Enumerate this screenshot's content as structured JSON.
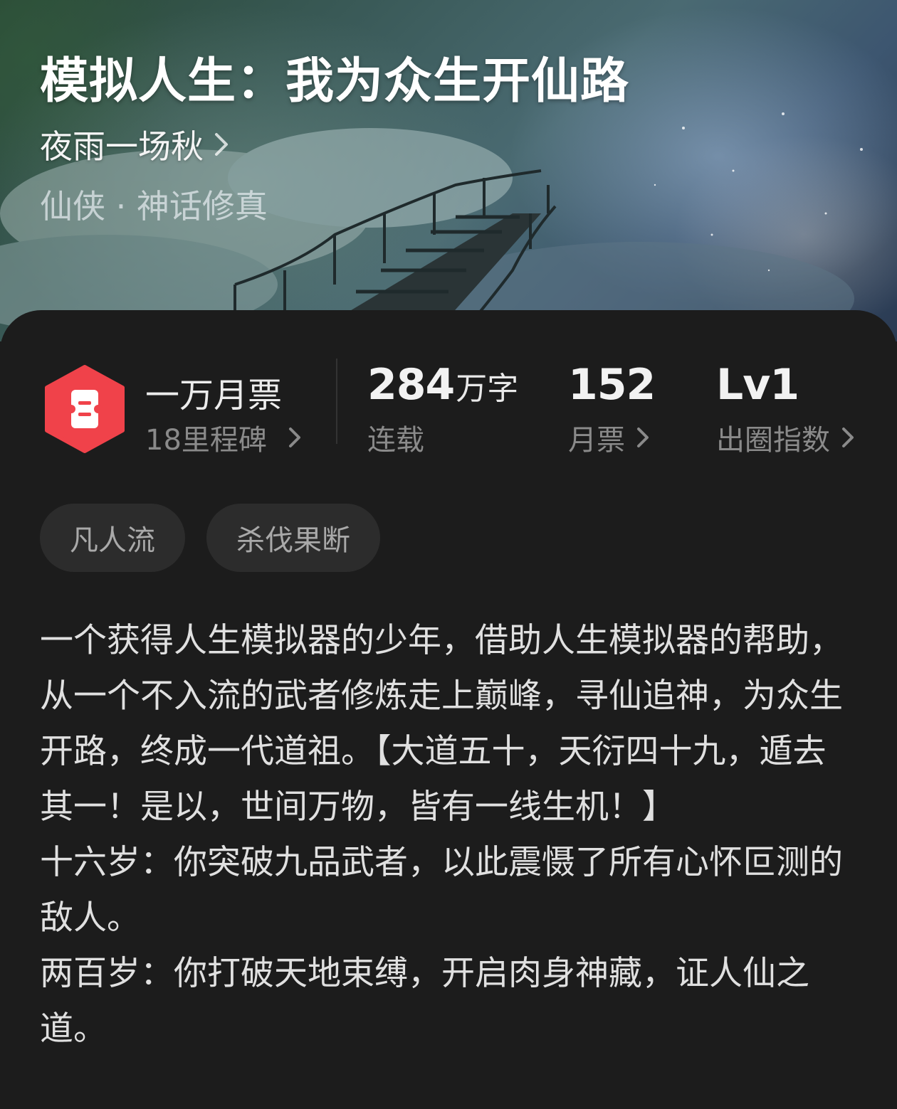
{
  "book": {
    "title": "模拟人生：我为众生开仙路",
    "author": "夜雨一场秋",
    "genre": "仙侠 · 神话修真"
  },
  "stats": {
    "badge": {
      "title": "一万月票",
      "subtitle": "18里程碑"
    },
    "word_count": {
      "number": "284",
      "unit": "万字",
      "label": "连载"
    },
    "monthly_tickets": {
      "number": "152",
      "label": "月票"
    },
    "influence": {
      "number": "Lv1",
      "label": "出圈指数"
    }
  },
  "tags": [
    "凡人流",
    "杀伐果断"
  ],
  "synopsis": [
    "一个获得人生模拟器的少年，借助人生模拟器的帮助，从一个不入流的武者修炼走上巅峰，寻仙追神，为众生开路，终成一代道祖。【大道五十，天衍四十九，遁去其一！是以，世间万物，皆有一线生机！】",
    "十六岁：你突破九品武者，以此震慑了所有心怀叵测的敌人。",
    "两百岁：你打破天地束缚，开启肉身神藏，证人仙之道。"
  ],
  "colors": {
    "badge_red": "#f0424a",
    "panel_bg": "#1c1c1c",
    "tag_bg": "#2c2c2c"
  },
  "icons": {
    "badge": "ticket-hexagon-icon",
    "chevron": "chevron-right-icon"
  }
}
